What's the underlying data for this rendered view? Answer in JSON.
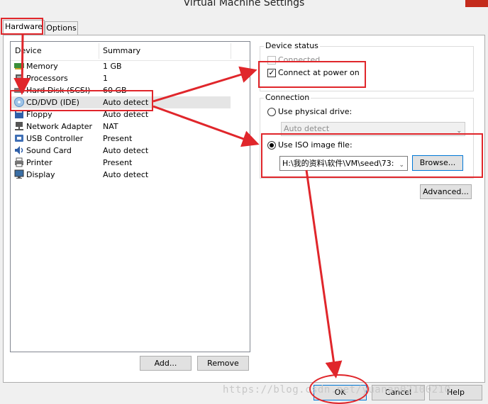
{
  "window": {
    "title": "Virtual Machine Settings"
  },
  "tabs": [
    {
      "label": "Hardware",
      "active": true
    },
    {
      "label": "Options",
      "active": false
    }
  ],
  "device_list": {
    "columns": [
      "Device",
      "Summary"
    ],
    "rows": [
      {
        "icon": "memory-icon",
        "name": "Memory",
        "summary": "1 GB"
      },
      {
        "icon": "processor-icon",
        "name": "Processors",
        "summary": "1"
      },
      {
        "icon": "hard-disk-icon",
        "name": "Hard Disk (SCSI)",
        "summary": "60 GB"
      },
      {
        "icon": "cd-dvd-icon",
        "name": "CD/DVD (IDE)",
        "summary": "Auto detect",
        "selected": true
      },
      {
        "icon": "floppy-icon",
        "name": "Floppy",
        "summary": "Auto detect"
      },
      {
        "icon": "network-adapter-icon",
        "name": "Network Adapter",
        "summary": "NAT"
      },
      {
        "icon": "usb-controller-icon",
        "name": "USB Controller",
        "summary": "Present"
      },
      {
        "icon": "sound-card-icon",
        "name": "Sound Card",
        "summary": "Auto detect"
      },
      {
        "icon": "printer-icon",
        "name": "Printer",
        "summary": "Present"
      },
      {
        "icon": "display-icon",
        "name": "Display",
        "summary": "Auto detect"
      }
    ]
  },
  "list_buttons": {
    "add": "Add...",
    "remove": "Remove"
  },
  "device_status": {
    "label": "Device status",
    "connected": {
      "label": "Connected",
      "checked": false,
      "enabled": false
    },
    "connect_at_power_on": {
      "label": "Connect at power on",
      "checked": true
    }
  },
  "connection": {
    "label": "Connection",
    "physical_drive": {
      "label": "Use physical drive:",
      "selected": false,
      "value": "Auto detect"
    },
    "iso_image": {
      "label": "Use ISO image file:",
      "selected": true,
      "value": "H:\\我的资料\\软件\\VM\\seed\\73:"
    },
    "browse_label": "Browse...",
    "advanced_label": "Advanced..."
  },
  "dialog_buttons": {
    "ok": "OK",
    "cancel": "Cancel",
    "help": "Help"
  },
  "watermark": "https://blog.csdn.net/yuanan02100210",
  "annotation_color": "#e0262b"
}
